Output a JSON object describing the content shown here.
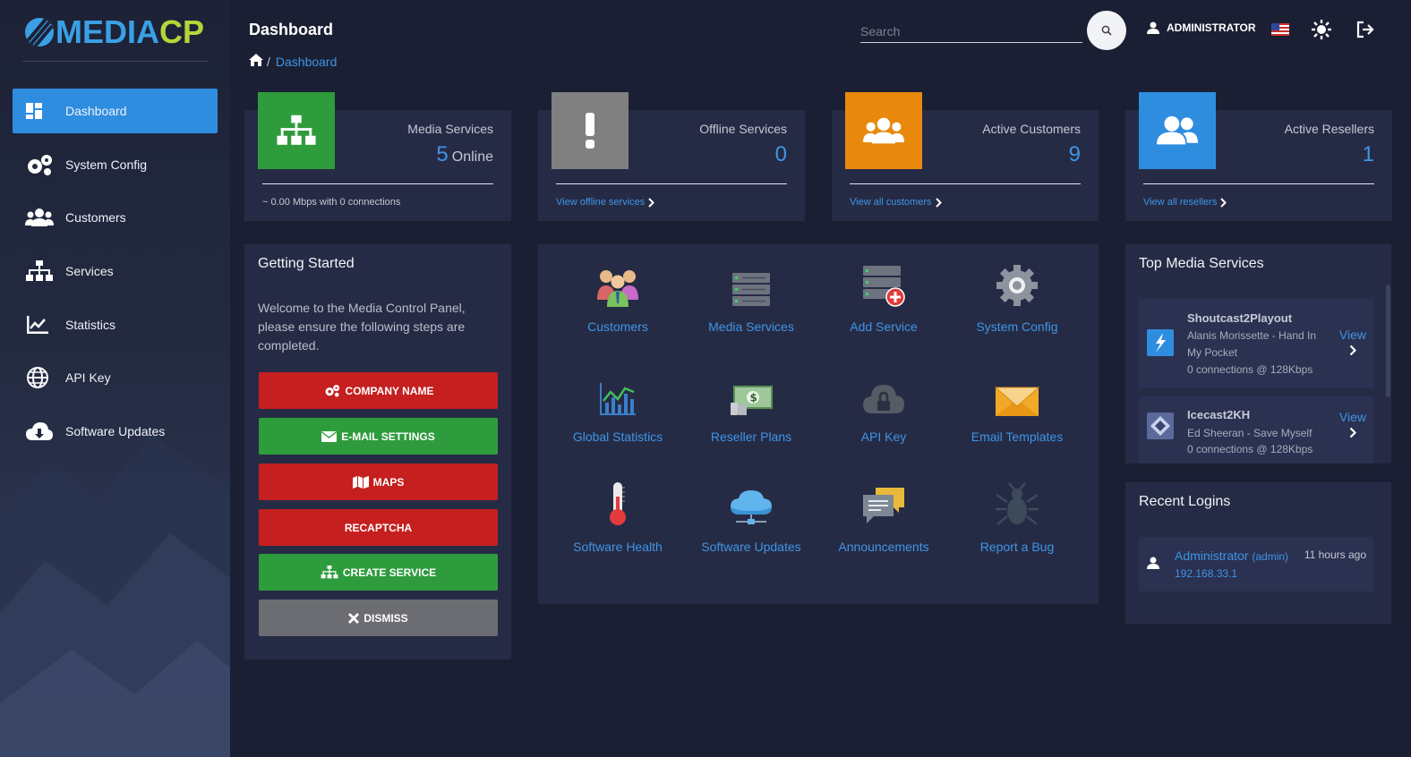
{
  "brand": {
    "logo_main": "MEDIA",
    "logo_accent": "CP"
  },
  "header": {
    "title": "Dashboard",
    "breadcrumb": {
      "separator": "/",
      "current": "Dashboard"
    },
    "search": {
      "placeholder": "Search",
      "value": ""
    },
    "user": "ADMINISTRATOR"
  },
  "sidebar": {
    "items": [
      {
        "label": "Dashboard",
        "icon": "dashboard-icon",
        "active": true
      },
      {
        "label": "System Config",
        "icon": "gears-icon"
      },
      {
        "label": "Customers",
        "icon": "users-icon"
      },
      {
        "label": "Services",
        "icon": "sitemap-icon"
      },
      {
        "label": "Statistics",
        "icon": "line-chart-icon"
      },
      {
        "label": "API Key",
        "icon": "globe-icon"
      },
      {
        "label": "Software Updates",
        "icon": "cloud-download-icon"
      }
    ]
  },
  "stats": [
    {
      "label": "Media Services",
      "value": "5",
      "unit": "Online",
      "footer": "~ 0.00 Mbps with 0 connections",
      "color": "#2e9c3c",
      "icon": "sitemap-icon"
    },
    {
      "label": "Offline Services",
      "value": "0",
      "footer": "View offline services",
      "color": "#808080",
      "icon": "exclamation-icon"
    },
    {
      "label": "Active Customers",
      "value": "9",
      "footer": "View all customers",
      "color": "#e8890e",
      "icon": "users-icon"
    },
    {
      "label": "Active Resellers",
      "value": "1",
      "footer": "View all resellers",
      "color": "#2f8de0",
      "icon": "user-friends-icon"
    }
  ],
  "getting_started": {
    "title": "Getting Started",
    "text": "Welcome to the Media Control Panel, please ensure the following steps are completed.",
    "buttons": [
      {
        "label": "COMPANY NAME",
        "color": "#c51f1f",
        "icon": "gears-icon"
      },
      {
        "label": "E-MAIL SETTINGS",
        "color": "#2e9c3c",
        "icon": "envelope-icon"
      },
      {
        "label": "MAPS",
        "color": "#c51f1f",
        "icon": "map-icon"
      },
      {
        "label": "RECAPTCHA",
        "color": "#c51f1f",
        "icon": ""
      },
      {
        "label": "CREATE SERVICE",
        "color": "#2e9c3c",
        "icon": "sitemap-icon"
      },
      {
        "label": "DISMISS",
        "color": "#6c6d72",
        "icon": "close-icon"
      }
    ]
  },
  "shortcuts": [
    {
      "label": "Customers",
      "icon": "people-group-icon"
    },
    {
      "label": "Media Services",
      "icon": "server-icon"
    },
    {
      "label": "Add Service",
      "icon": "server-add-icon"
    },
    {
      "label": "System Config",
      "icon": "cog-icon"
    },
    {
      "label": "Global Statistics",
      "icon": "bar-chart-icon"
    },
    {
      "label": "Reseller Plans",
      "icon": "money-icon"
    },
    {
      "label": "API Key",
      "icon": "cloud-lock-icon"
    },
    {
      "label": "Email Templates",
      "icon": "envelope-icon"
    },
    {
      "label": "Software Health",
      "icon": "thermometer-icon"
    },
    {
      "label": "Software Updates",
      "icon": "cloud-network-icon"
    },
    {
      "label": "Announcements",
      "icon": "chat-bubbles-icon"
    },
    {
      "label": "Report a Bug",
      "icon": "bug-icon"
    }
  ],
  "top_media_services": {
    "title": "Top Media Services",
    "items": [
      {
        "name": "Shoutcast2Playout",
        "track": "Alanis Morissette - Hand In My Pocket",
        "connections": "0 connections @ 128Kbps",
        "action": "View"
      },
      {
        "name": "Icecast2KH",
        "track": "Ed Sheeran - Save Myself",
        "connections": "0 connections @ 128Kbps",
        "action": "View"
      }
    ]
  },
  "recent_logins": {
    "title": "Recent Logins",
    "items": [
      {
        "name": "Administrator",
        "role": "(admin)",
        "ip": "192.168.33.1",
        "time": "11 hours ago"
      }
    ]
  },
  "colors": {
    "accent": "#2f8de0",
    "link": "#3e95e6",
    "panel": "#262b45",
    "background": "#1b1f33"
  }
}
